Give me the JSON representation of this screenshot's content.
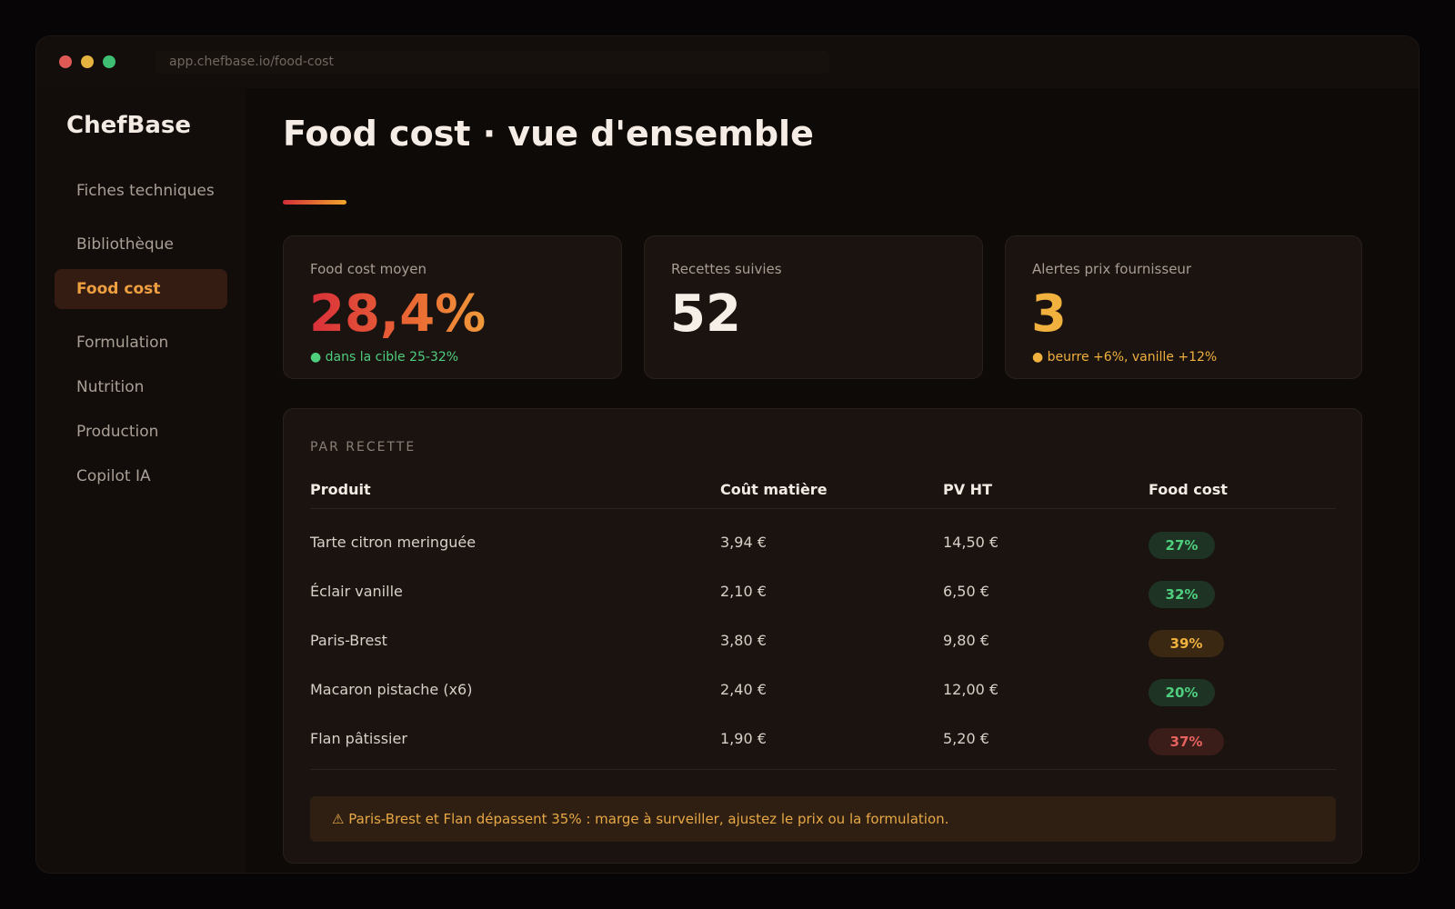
{
  "browser": {
    "url": "app.chefbase.io/food-cost"
  },
  "sidebar": {
    "brand": "ChefBase",
    "items": [
      {
        "label": "Fiches techniques"
      },
      {
        "label": "Bibliothèque"
      },
      {
        "label": "Food cost",
        "active": true
      },
      {
        "label": "Formulation"
      },
      {
        "label": "Nutrition"
      },
      {
        "label": "Production"
      },
      {
        "label": "Copilot IA"
      }
    ]
  },
  "header": {
    "title": "Food cost · vue d'ensemble"
  },
  "kpis": [
    {
      "label": "Food cost moyen",
      "value": "28,4%",
      "note": "● dans la cible 25-32%",
      "note_color": "#4fce7e"
    },
    {
      "label": "Recettes suivies",
      "value": "52"
    },
    {
      "label": "Alertes prix fournisseur",
      "value": "3",
      "value_color": "#f0b13e",
      "note": "● beurre +6%, vanille +12%",
      "note_color": "#f0b13e"
    }
  ],
  "table": {
    "section_label": "PAR RECETTE",
    "headers": [
      "Produit",
      "Coût matière",
      "PV HT",
      "Food cost"
    ],
    "rows": [
      {
        "product": "Tarte citron meringuée",
        "cost": "3,94 €",
        "price": "14,50 €",
        "food_cost": "27%",
        "status": "green"
      },
      {
        "product": "Éclair vanille",
        "cost": "2,10 €",
        "price": "6,50 €",
        "food_cost": "32%",
        "status": "green"
      },
      {
        "product": "Paris-Brest",
        "cost": "3,80 €",
        "price": "9,80 €",
        "food_cost": "39%",
        "status": "amber"
      },
      {
        "product": "Macaron pistache (x6)",
        "cost": "2,40 €",
        "price": "12,00 €",
        "food_cost": "20%",
        "status": "green"
      },
      {
        "product": "Flan pâtissier",
        "cost": "1,90 €",
        "price": "5,20 €",
        "food_cost": "37%",
        "status": "red"
      }
    ]
  },
  "alert": {
    "text": "⚠ Paris-Brest et Flan dépassent 35% : marge à surveiller, ajustez le prix ou la formulation."
  }
}
